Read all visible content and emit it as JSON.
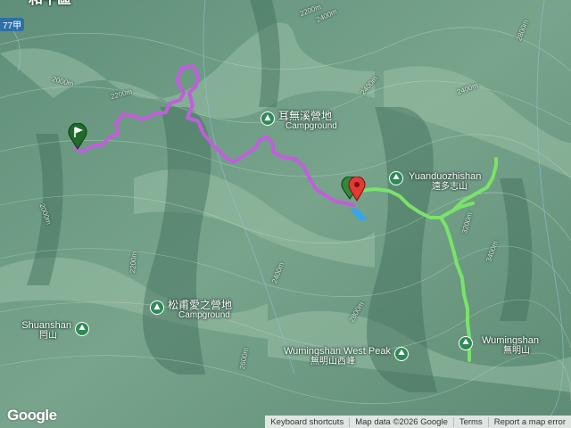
{
  "map": {
    "top_label": "和平區",
    "corner_badge": "77甲",
    "campgrounds": [
      {
        "name": "耳無溪營地",
        "sub": "Campground"
      },
      {
        "name": "松甫愛之營地",
        "sub": "Campground"
      }
    ],
    "peaks": [
      {
        "en": "Yuanduozhishan",
        "zh": "遠多志山"
      },
      {
        "en": "Wumingshan",
        "zh": "無明山"
      },
      {
        "en": "Wumingshan West Peak",
        "zh": "無明山西峰"
      },
      {
        "en": "Shuanshan",
        "zh": "閂山"
      }
    ],
    "contours": [
      "2000m",
      "2200m",
      "2400m",
      "2600m",
      "2800m",
      "3000m",
      "3200m",
      "3400m"
    ],
    "route_colors": {
      "section1": "#c25ddc",
      "section2": "#7ae36a",
      "water": "#3aa5e6"
    }
  },
  "footer": {
    "logo": "Google",
    "keyboard": "Keyboard shortcuts",
    "mapdata": "Map data ©2026 Google",
    "terms": "Terms",
    "report": "Report a map error"
  }
}
